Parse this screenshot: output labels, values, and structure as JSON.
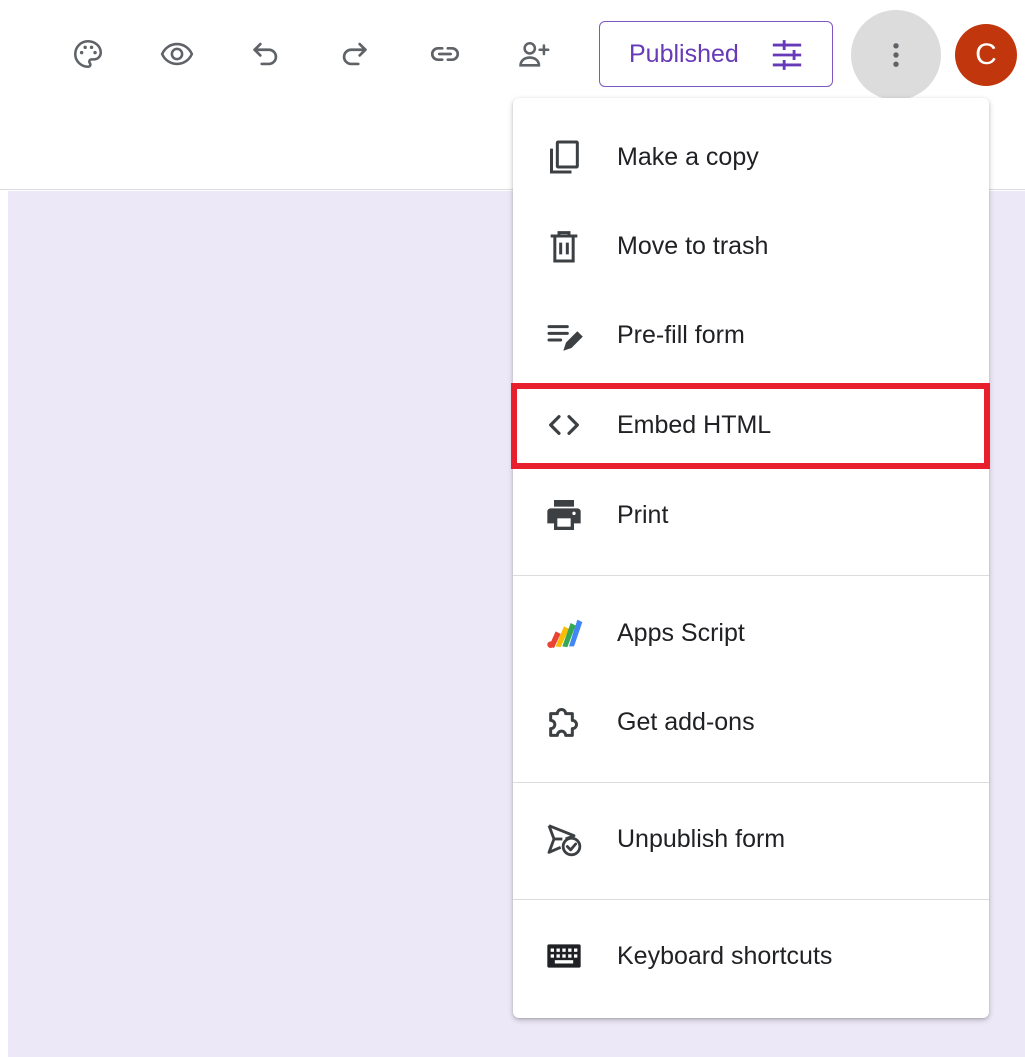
{
  "toolbar": {
    "icons": [
      {
        "name": "palette-icon",
        "label": "Customize theme"
      },
      {
        "name": "eye-icon",
        "label": "Preview"
      },
      {
        "name": "undo-icon",
        "label": "Undo"
      },
      {
        "name": "redo-icon",
        "label": "Redo"
      },
      {
        "name": "link-icon",
        "label": "Copy link"
      },
      {
        "name": "add-person-icon",
        "label": "Add collaborators"
      }
    ],
    "published_label": "Published",
    "avatar_initial": "C"
  },
  "menu": {
    "items": [
      {
        "label": "Make a copy",
        "icon": "copy-icon"
      },
      {
        "label": "Move to trash",
        "icon": "trash-icon"
      },
      {
        "label": "Pre-fill form",
        "icon": "edit-note-icon"
      },
      {
        "label": "Embed HTML",
        "icon": "code-icon",
        "highlighted": true
      },
      {
        "label": "Print",
        "icon": "print-icon"
      },
      {
        "label": "Apps Script",
        "icon": "apps-script-icon"
      },
      {
        "label": "Get add-ons",
        "icon": "puzzle-icon"
      },
      {
        "label": "Unpublish form",
        "icon": "unpublish-icon"
      },
      {
        "label": "Keyboard shortcuts",
        "icon": "keyboard-icon"
      }
    ]
  },
  "colors": {
    "accent": "#673ab7",
    "canvas": "#ede8f7",
    "avatar": "#c1360c",
    "highlight": "#e8202e"
  }
}
